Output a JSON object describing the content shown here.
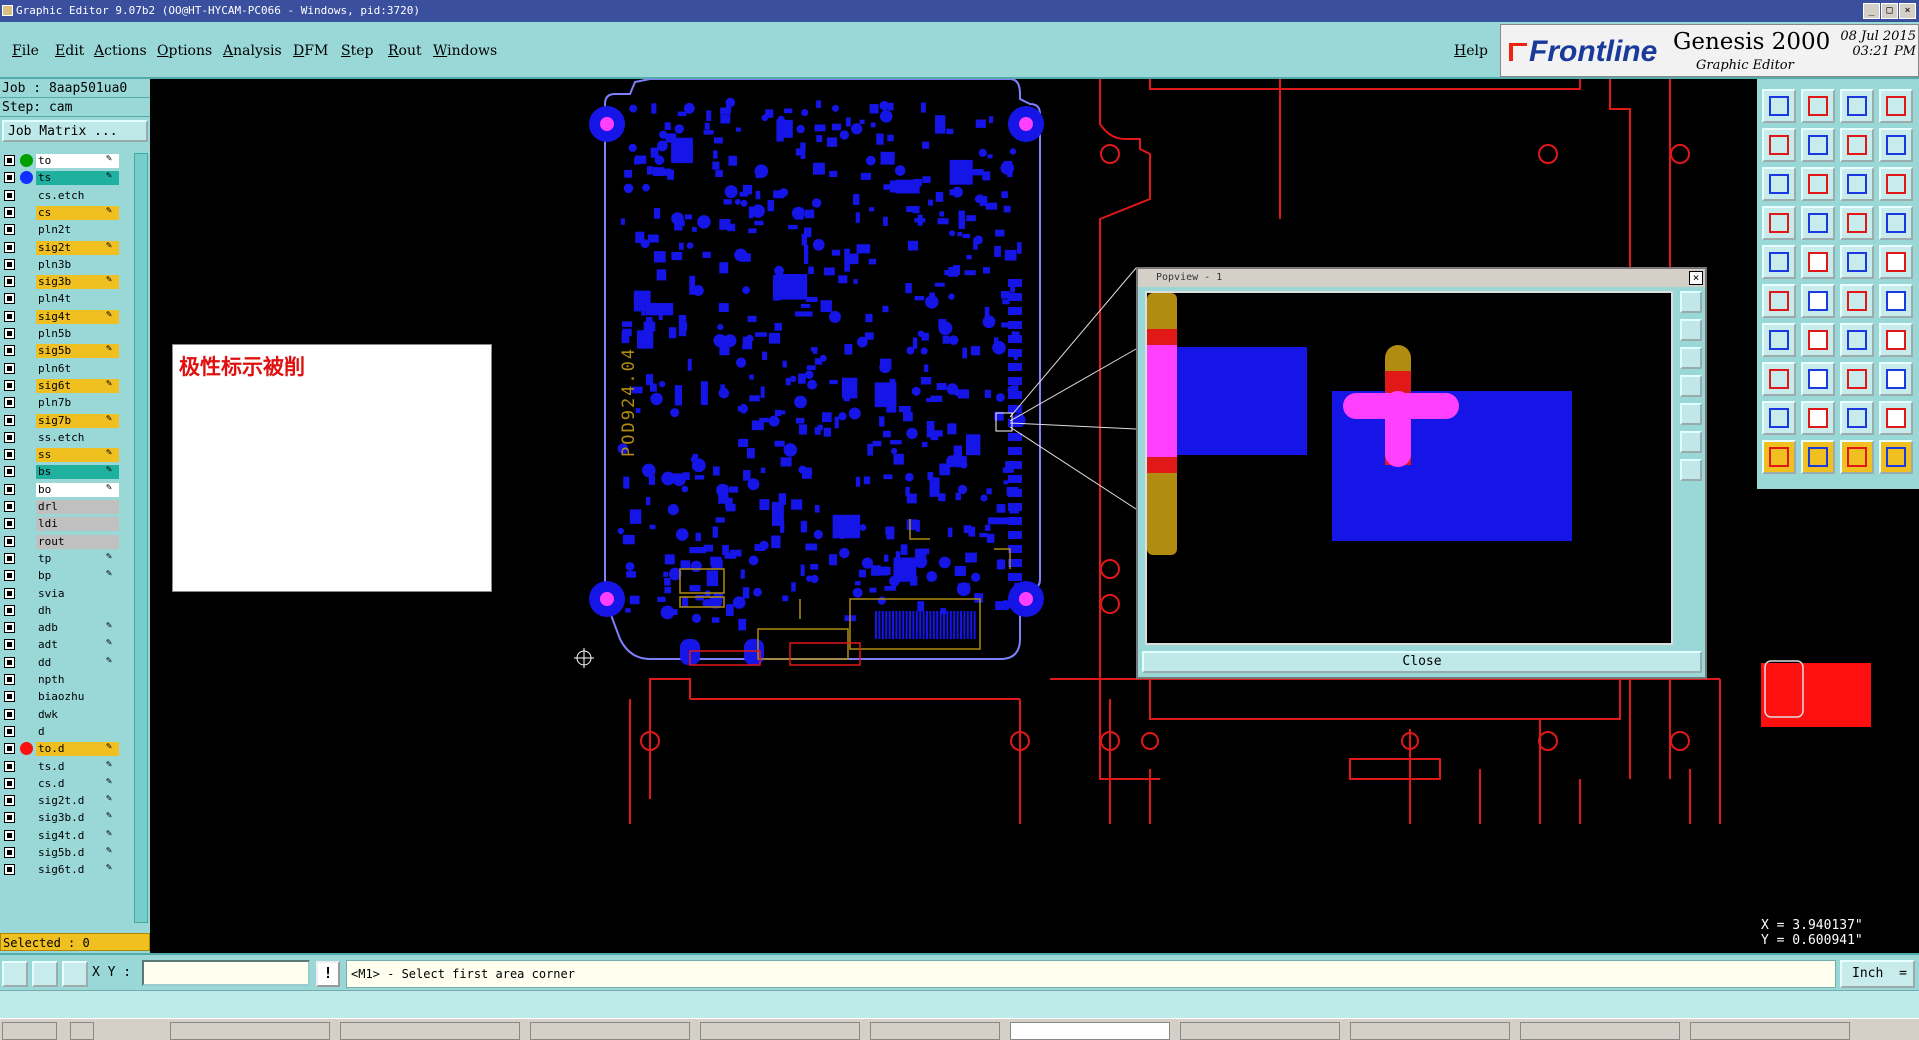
{
  "window": {
    "title": "Graphic Editor 9.07b2 (OO@HT-HYCAM-PC066 - Windows, pid:3720)"
  },
  "menu": {
    "items": [
      "File",
      "Edit",
      "Actions",
      "Options",
      "Analysis",
      "DFM",
      "Step",
      "Rout",
      "Windows"
    ],
    "help": "Help"
  },
  "brand": {
    "logo": "Frontline",
    "product": "Genesis 2000",
    "subtitle": "Graphic Editor",
    "date": "08 Jul 2015",
    "time": "03:21 PM"
  },
  "job": {
    "job_line": "Job : 8aap501ua0",
    "step_line": "Step: cam",
    "matrix_button": "Job Matrix ..."
  },
  "layers": [
    {
      "name": "to",
      "color": "#ffffff",
      "dot": "#00a000",
      "edit": true
    },
    {
      "name": "ts",
      "color": "#20b0a0",
      "dot": "#1030ff",
      "edit": true
    },
    {
      "name": "cs.etch",
      "color": "#9ad8d8",
      "dot": "",
      "edit": false
    },
    {
      "name": "cs",
      "color": "#f0c020",
      "dot": "",
      "edit": true
    },
    {
      "name": "pln2t",
      "color": "#9ad8d8",
      "dot": "",
      "edit": false
    },
    {
      "name": "sig2t",
      "color": "#f0c020",
      "dot": "",
      "edit": true
    },
    {
      "name": "pln3b",
      "color": "#9ad8d8",
      "dot": "",
      "edit": false
    },
    {
      "name": "sig3b",
      "color": "#f0c020",
      "dot": "",
      "edit": true
    },
    {
      "name": "pln4t",
      "color": "#9ad8d8",
      "dot": "",
      "edit": false
    },
    {
      "name": "sig4t",
      "color": "#f0c020",
      "dot": "",
      "edit": true
    },
    {
      "name": "pln5b",
      "color": "#9ad8d8",
      "dot": "",
      "edit": false
    },
    {
      "name": "sig5b",
      "color": "#f0c020",
      "dot": "",
      "edit": true
    },
    {
      "name": "pln6t",
      "color": "#9ad8d8",
      "dot": "",
      "edit": false
    },
    {
      "name": "sig6t",
      "color": "#f0c020",
      "dot": "",
      "edit": true
    },
    {
      "name": "pln7b",
      "color": "#9ad8d8",
      "dot": "",
      "edit": false
    },
    {
      "name": "sig7b",
      "color": "#f0c020",
      "dot": "",
      "edit": true
    },
    {
      "name": "ss.etch",
      "color": "#9ad8d8",
      "dot": "",
      "edit": false
    },
    {
      "name": "ss",
      "color": "#f0c020",
      "dot": "",
      "edit": true
    },
    {
      "name": "bs",
      "color": "#20b0a0",
      "dot": "",
      "edit": true
    },
    {
      "name": "bo",
      "color": "#ffffff",
      "dot": "",
      "edit": true
    },
    {
      "name": "drl",
      "color": "#c0c0c0",
      "dot": "",
      "edit": false
    },
    {
      "name": "ldi",
      "color": "#c0c0c0",
      "dot": "",
      "edit": false
    },
    {
      "name": "rout",
      "color": "#c0c0c0",
      "dot": "",
      "edit": false
    },
    {
      "name": "tp",
      "color": "#9ad8d8",
      "dot": "",
      "edit": true
    },
    {
      "name": "bp",
      "color": "#9ad8d8",
      "dot": "",
      "edit": true
    },
    {
      "name": "svia",
      "color": "#9ad8d8",
      "dot": "",
      "edit": false
    },
    {
      "name": "dh",
      "color": "#9ad8d8",
      "dot": "",
      "edit": false
    },
    {
      "name": "adb",
      "color": "#9ad8d8",
      "dot": "",
      "edit": true
    },
    {
      "name": "adt",
      "color": "#9ad8d8",
      "dot": "",
      "edit": true
    },
    {
      "name": "dd",
      "color": "#9ad8d8",
      "dot": "",
      "edit": true
    },
    {
      "name": "npth",
      "color": "#9ad8d8",
      "dot": "",
      "edit": false
    },
    {
      "name": "biaozhu",
      "color": "#9ad8d8",
      "dot": "",
      "edit": false
    },
    {
      "name": "dwk",
      "color": "#9ad8d8",
      "dot": "",
      "edit": false
    },
    {
      "name": "d",
      "color": "#9ad8d8",
      "dot": "",
      "edit": false
    },
    {
      "name": "to.d",
      "color": "#f0c020",
      "dot": "#ff1010",
      "edit": true
    },
    {
      "name": "ts.d",
      "color": "#9ad8d8",
      "dot": "",
      "edit": true
    },
    {
      "name": "cs.d",
      "color": "#9ad8d8",
      "dot": "",
      "edit": true
    },
    {
      "name": "sig2t.d",
      "color": "#9ad8d8",
      "dot": "",
      "edit": true
    },
    {
      "name": "sig3b.d",
      "color": "#9ad8d8",
      "dot": "",
      "edit": true
    },
    {
      "name": "sig4t.d",
      "color": "#9ad8d8",
      "dot": "",
      "edit": true
    },
    {
      "name": "sig5b.d",
      "color": "#9ad8d8",
      "dot": "",
      "edit": true
    },
    {
      "name": "sig6t.d",
      "color": "#9ad8d8",
      "dot": "",
      "edit": true
    }
  ],
  "selected_text": "Selected : 0",
  "canvas": {
    "note": "极性标示被削",
    "board_label": "POD924.04"
  },
  "popview": {
    "title": "Popview - 1",
    "close_label": "Close"
  },
  "coords": {
    "x_line": "X = 3.940137\"",
    "y_line": "Y = 0.600941\""
  },
  "statusbar": {
    "xy_label": "X Y :",
    "xy_value": "",
    "warn": "!",
    "prompt": "<M1> - Select first area corner",
    "unit": "Inch"
  },
  "colors": {
    "panel": "#9ad8d8",
    "copper": "#1515e8",
    "outline": "#e01818",
    "gold": "#b08c10",
    "magenta": "#ff40ff"
  }
}
